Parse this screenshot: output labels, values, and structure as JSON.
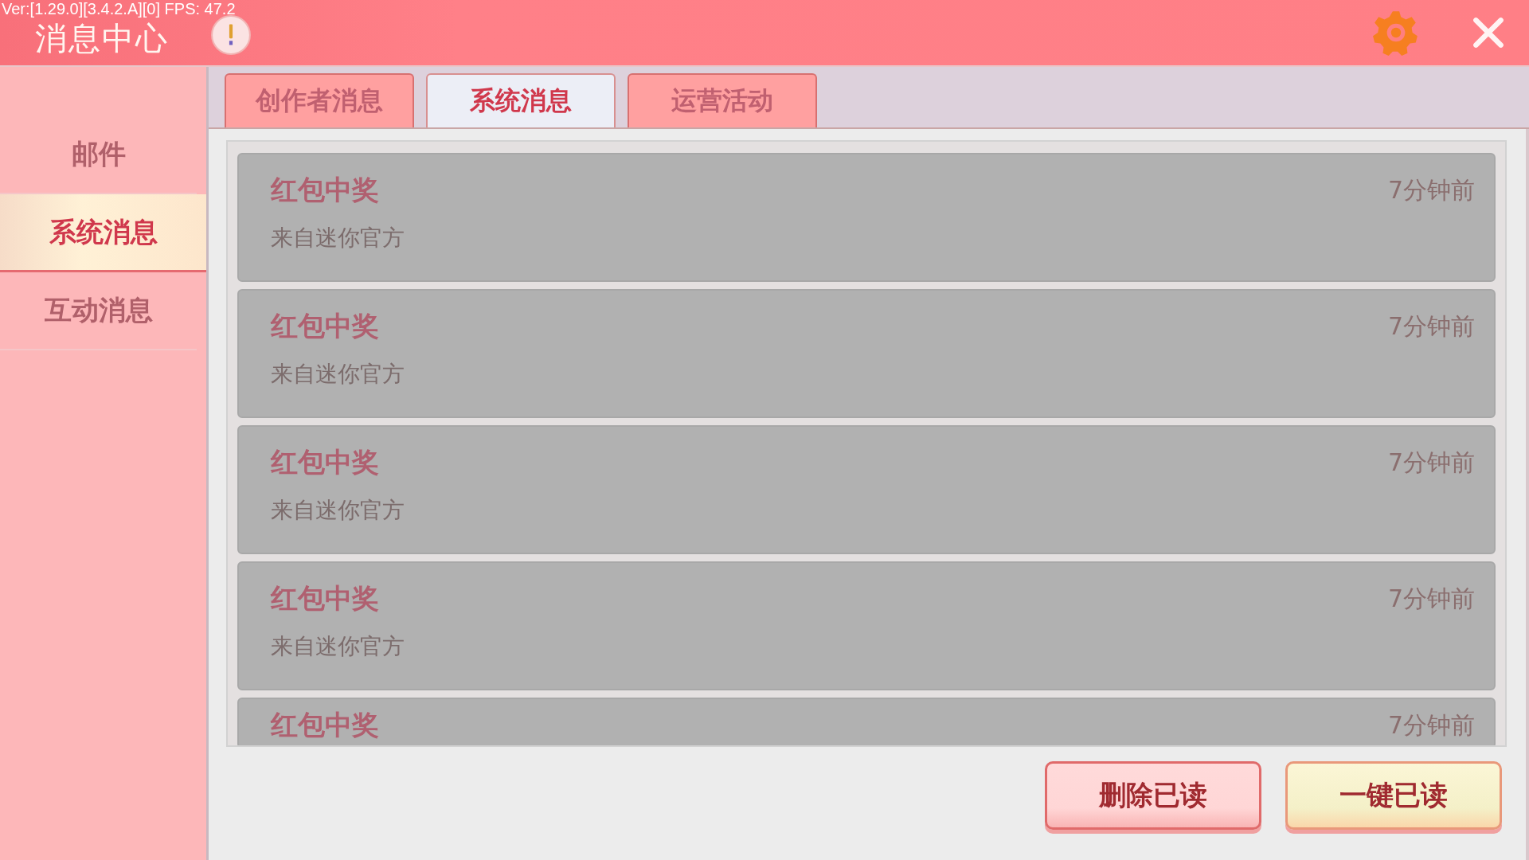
{
  "debug_overlay": "Ver:[1.29.0][3.4.2.A][0] FPS: 47.2",
  "window": {
    "title": "消息中心"
  },
  "sidebar": {
    "items": [
      {
        "label": "邮件",
        "selected": false
      },
      {
        "label": "系统消息",
        "selected": true
      },
      {
        "label": "互动消息",
        "selected": false
      }
    ]
  },
  "tabs": [
    {
      "label": "创作者消息",
      "selected": false
    },
    {
      "label": "系统消息",
      "selected": true
    },
    {
      "label": "运营活动",
      "selected": false
    }
  ],
  "messages": [
    {
      "title": "红包中奖",
      "sender": "来自迷你官方",
      "time": "7分钟前",
      "read": true
    },
    {
      "title": "红包中奖",
      "sender": "来自迷你官方",
      "time": "7分钟前",
      "read": true
    },
    {
      "title": "红包中奖",
      "sender": "来自迷你官方",
      "time": "7分钟前",
      "read": true
    },
    {
      "title": "红包中奖",
      "sender": "来自迷你官方",
      "time": "7分钟前",
      "read": true
    },
    {
      "title": "红包中奖",
      "time": "7分钟前",
      "read": true
    }
  ],
  "buttons": [
    {
      "label": "删除已读",
      "kind": "delete"
    },
    {
      "label": "一键已读",
      "kind": "mark"
    }
  ]
}
